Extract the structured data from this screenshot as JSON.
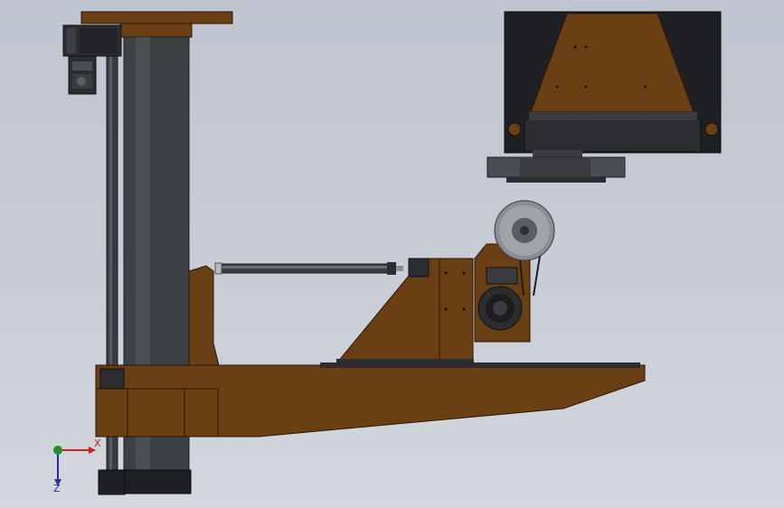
{
  "colors": {
    "background_top": "#bfc5d0",
    "background_bottom": "#d4d7dd",
    "wood": "#6b3f14",
    "wood_dark": "#4e2c0c",
    "wood_edge": "#2a1706",
    "steel_dark": "#2b2d31",
    "steel_mid": "#4a4d52",
    "steel_light": "#8a8d92",
    "axis_x": "#cc2222",
    "axis_y": "#2a8a2a",
    "axis_z": "#2233aa"
  },
  "triad": {
    "x_label": "X",
    "z_label": "Z"
  },
  "icons": {
    "motor": "gearmotor-icon",
    "spindle": "spindle-motor-icon",
    "roller": "roller-wheel-icon",
    "triad": "coordinate-triad-icon"
  }
}
